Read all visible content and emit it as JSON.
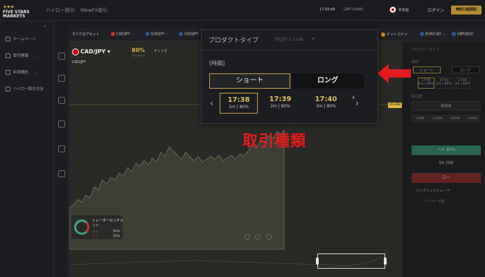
{
  "header": {
    "logo_line1": "FIVE STARS",
    "logo_line2": "MARKETS",
    "nav": [
      "ハイロー取引",
      "WowFX取引"
    ],
    "clock": "17:50:49",
    "timezone": "GMT+0900",
    "language": "日本語",
    "login": "ログイン",
    "open_account": "無料口座開設"
  },
  "sidebar": {
    "items": [
      {
        "label": "ホームページ",
        "icon": "home-icon"
      },
      {
        "label": "取引情報",
        "icon": "info-icon",
        "expandable": true
      },
      {
        "label": "利用規約",
        "icon": "document-icon",
        "expandable": true
      },
      {
        "label": "ハイロー取引方法",
        "icon": "help-icon"
      }
    ]
  },
  "assets": {
    "all_label": "すべてのアセット",
    "tabs": [
      "CAD/JPY",
      "EUR/JPY",
      "USD/JPY",
      "ビットコイン",
      "EUR/CAD",
      "GBP/AUD"
    ]
  },
  "chart": {
    "pair": "CAD/JPY",
    "pair_sub": "CAD/JPY",
    "payout": "80%",
    "payout_label": "ペイアウト",
    "tools_label": "ティック",
    "price_tag": "99.388"
  },
  "sentiment": {
    "title_line1": "トレーダーセンチメ",
    "title_line2": "ント",
    "high_label": "ハイ",
    "high_value": "50%",
    "low_label": "ロー",
    "low_value": "50%"
  },
  "order_panel": {
    "product_type_label": "プロダクトタイプ",
    "time_label": "時間",
    "tab_short": "ショート",
    "tab_long": "ロング",
    "times": [
      {
        "time": "17:02",
        "sub": "1m | 80%"
      },
      {
        "time": "17:03",
        "sub": "2m | 80%"
      },
      {
        "time": "17:04",
        "sub": "3m | 80%"
      }
    ],
    "amount_label": "取引額",
    "amount_value": "¥500",
    "increments": [
      "+100",
      "+1000",
      "+2000",
      "+5000"
    ],
    "high_button": "ハイ",
    "high_payout": "80%",
    "mid_price": "99.388",
    "low_button": "ロー",
    "one_click": "ワンクリックトレード",
    "payout_info": "ペイアウト情報"
  },
  "popup": {
    "product_type_label": "プロダクトタイプ",
    "product_type_value": "High / Low",
    "time_label": "[時間]",
    "tab_short": "ショート",
    "tab_long": "ロング",
    "options": [
      {
        "time": "17:38",
        "sub": "1m | 80%"
      },
      {
        "time": "17:39",
        "sub": "2m | 80%"
      },
      {
        "time": "17:40",
        "sub": "3m | 80%"
      },
      {
        "time": "",
        "sub": "4"
      }
    ]
  },
  "annotation": {
    "text": "取引種類",
    "color": "#e51c1c"
  },
  "colors": {
    "accent_gold": "#c8a84a",
    "high_green": "#2f8f6f",
    "low_red": "#8f2b2b"
  }
}
